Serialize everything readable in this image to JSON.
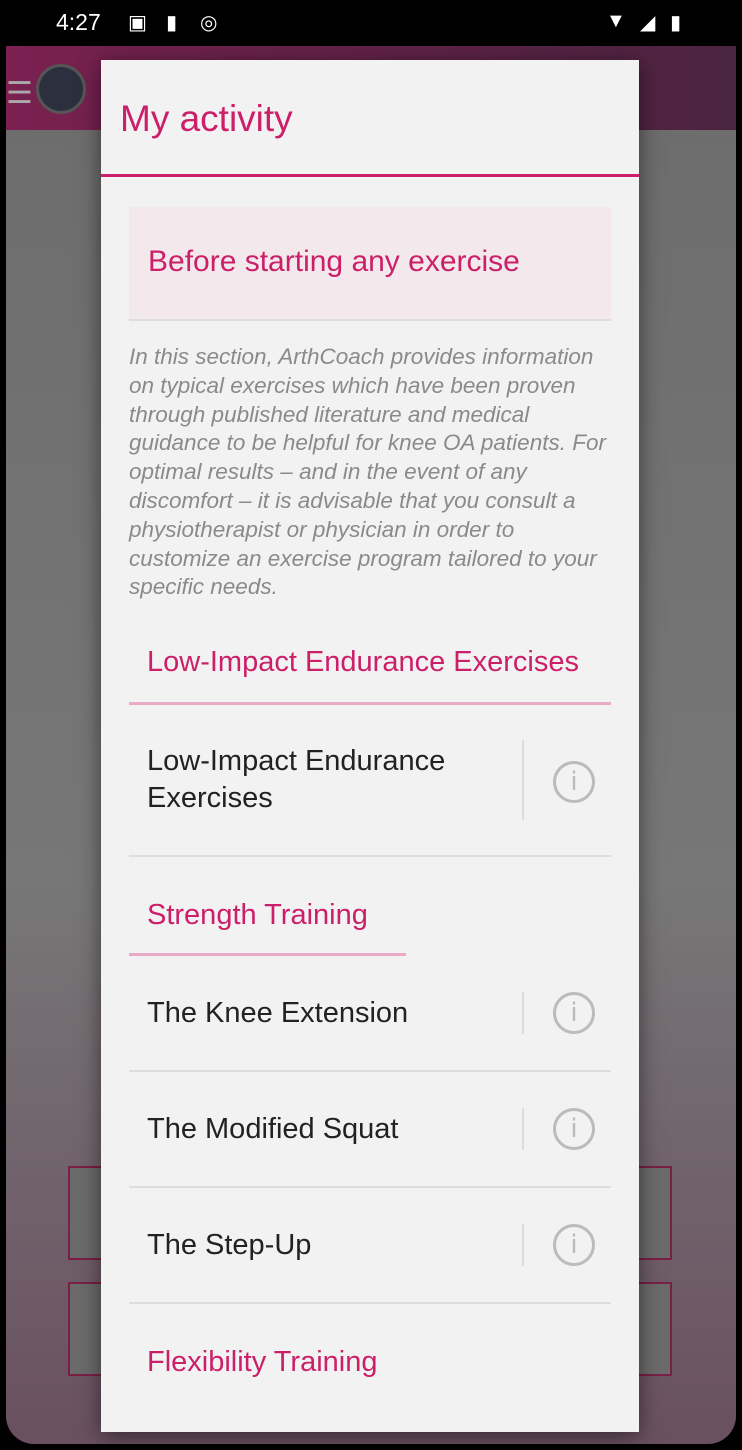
{
  "status_bar": {
    "time": "4:27"
  },
  "dialog": {
    "title": "My activity",
    "intro_card": {
      "title": "Before starting any exercise"
    },
    "intro_text": "In this section, ArthCoach provides information on typical exercises which have been proven through published literature and medical guidance to be helpful for knee OA patients. For optimal results – and in the event of any discomfort – it is advisable that you consult a physiotherapist or physician in order to customize an exercise program tailored to your specific needs.",
    "sections": [
      {
        "title": "Low-Impact Endurance Exercises",
        "items": [
          "Low-Impact Endurance Exercises"
        ]
      },
      {
        "title": "Strength Training",
        "items": [
          "The Knee Extension",
          "The Modified Squat",
          "The Step-Up"
        ]
      },
      {
        "title": "Flexibility Training",
        "items": []
      }
    ]
  },
  "colors": {
    "accent": "#cc1f6a",
    "underline": "#e8aac4"
  }
}
